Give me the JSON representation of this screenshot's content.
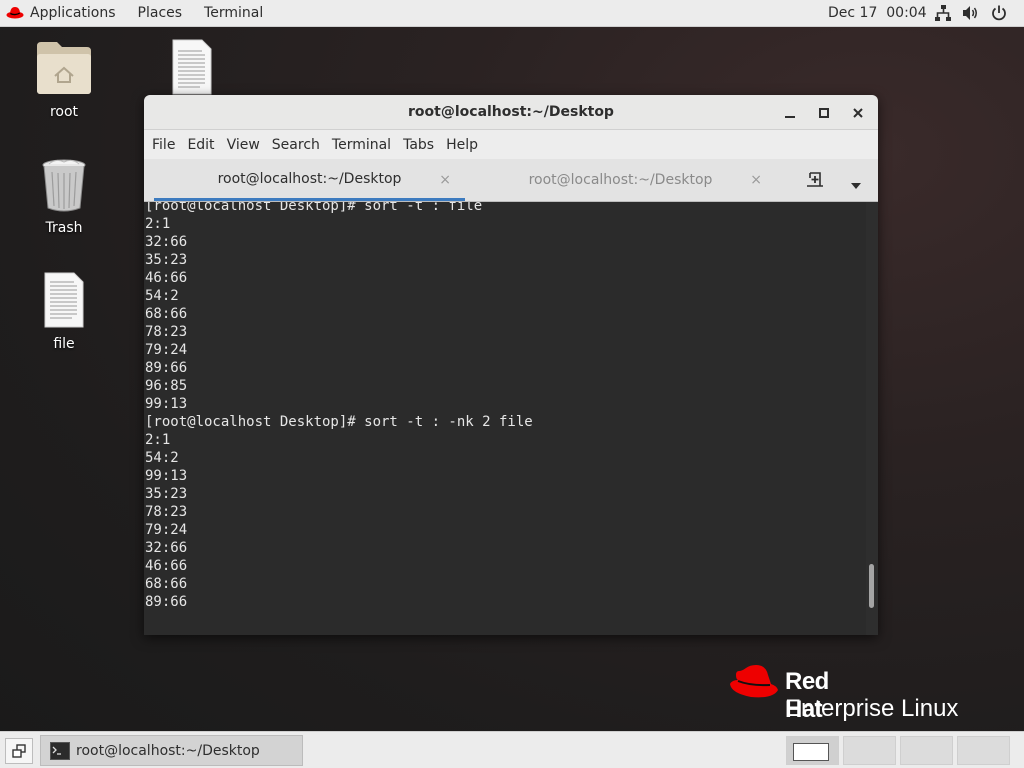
{
  "topbar": {
    "applications": "Applications",
    "places": "Places",
    "terminal": "Terminal",
    "clock": "Dec 17  00:04",
    "icons": [
      "network-icon",
      "volume-icon",
      "power-icon"
    ]
  },
  "desktop": {
    "icons": [
      {
        "label": "root",
        "icon": "home-folder-icon"
      },
      {
        "label": "Trash",
        "icon": "trash-icon"
      },
      {
        "label": "file",
        "icon": "text-file-icon"
      }
    ]
  },
  "window": {
    "title": "root@localhost:~/Desktop",
    "menu": [
      "File",
      "Edit",
      "View",
      "Search",
      "Terminal",
      "Tabs",
      "Help"
    ],
    "tabs": [
      {
        "label": "root@localhost:~/Desktop",
        "active": true
      },
      {
        "label": "root@localhost:~/Desktop",
        "active": false
      }
    ],
    "close_glyph": "×",
    "terminal_lines": [
      "[root@localhost Desktop]# sort -t : file",
      "2:1",
      "32:66",
      "35:23",
      "46:66",
      "54:2",
      "68:66",
      "78:23",
      "79:24",
      "89:66",
      "96:85",
      "99:13",
      "[root@localhost Desktop]# sort -t : -nk 2 file",
      "2:1",
      "54:2",
      "99:13",
      "35:23",
      "78:23",
      "79:24",
      "32:66",
      "46:66",
      "68:66",
      "89:66"
    ],
    "scroll": {
      "position": 0.93,
      "visible_fraction": 0.1
    }
  },
  "branding": {
    "line1": "Red Hat",
    "line2": "Enterprise Linux",
    "color": "#ee0000"
  },
  "taskbar": {
    "item_label": "root@localhost:~/Desktop",
    "workspaces": 4,
    "active_workspace": 1
  },
  "colors": {
    "tab_underline": "#3d7bbf",
    "terminal_bg": "#2b2b2b",
    "terminal_fg": "#e6e6e6"
  }
}
